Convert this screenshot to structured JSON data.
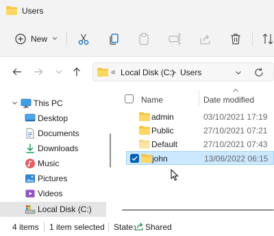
{
  "window": {
    "title": "Users"
  },
  "toolbar": {
    "new_label": "New",
    "icons": [
      "cut-icon",
      "copy-icon",
      "paste-icon",
      "rename-icon",
      "share-icon",
      "delete-icon",
      "sort-icon"
    ]
  },
  "address": {
    "overflow": "«",
    "crumbs": [
      "Local Disk (C:)",
      "Users"
    ],
    "separator": ">"
  },
  "sidebar": {
    "items": [
      {
        "label": "This PC",
        "icon": "monitor-icon"
      },
      {
        "label": "Desktop",
        "icon": "desktop-icon"
      },
      {
        "label": "Documents",
        "icon": "documents-icon"
      },
      {
        "label": "Downloads",
        "icon": "downloads-icon"
      },
      {
        "label": "Music",
        "icon": "music-icon"
      },
      {
        "label": "Pictures",
        "icon": "pictures-icon"
      },
      {
        "label": "Videos",
        "icon": "videos-icon"
      },
      {
        "label": "Local Disk (C:)",
        "icon": "drive-icon",
        "selected": true
      }
    ]
  },
  "columns": {
    "name": "Name",
    "date": "Date modified"
  },
  "files": [
    {
      "name": "admin",
      "date": "03/10/2021 17:19",
      "selected": false
    },
    {
      "name": "Public",
      "date": "27/10/2021 07:21",
      "selected": false
    },
    {
      "name": "Default",
      "date": "27/10/2021 07:43",
      "selected": false
    },
    {
      "name": "john",
      "date": "13/06/2022 06:15",
      "selected": true
    }
  ],
  "status": {
    "items_count": "4 items",
    "selected_count": "1 item selected",
    "state_label": "State:",
    "state_value": "Shared"
  },
  "colors": {
    "accent": "#005fb8",
    "folder": "#f8c43f",
    "selection": "#cce8ff"
  }
}
